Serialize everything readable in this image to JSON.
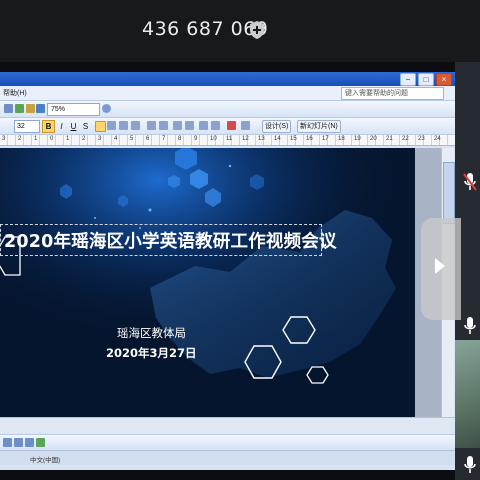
{
  "meeting": {
    "id": "436 687 069",
    "icon": "shield-plus-icon"
  },
  "ppt": {
    "window_buttons": [
      "−",
      "□",
      "×"
    ],
    "menu_help": "帮助(H)",
    "help_search_placeholder": "键入需要帮助的问题",
    "zoom": "75%",
    "font_size": "32",
    "format_buttons": [
      "B",
      "I",
      "U",
      "S"
    ],
    "design_button": "设计(S)",
    "new_slide_button": "新幻灯片(N)",
    "ruler_labels": [
      "3",
      "2",
      "1",
      "0",
      "1",
      "2",
      "3",
      "4",
      "5",
      "6",
      "7",
      "8",
      "9",
      "10",
      "11",
      "12",
      "13",
      "14",
      "15",
      "16",
      "17",
      "18",
      "19",
      "20",
      "21",
      "22",
      "23",
      "24"
    ],
    "status_language": "中文(中国)"
  },
  "slide": {
    "title": "2020年瑶海区小学英语教研工作视频会议",
    "organization": "瑶海区教体局",
    "date": "2020年3月27日",
    "colors": {
      "background": "#05152e",
      "accent": "#1f6fd6",
      "text": "#ffffff"
    }
  },
  "sidebar": {
    "icons": [
      "mic-muted-icon",
      "arrow-right-icon",
      "mic-icon",
      "mic-icon"
    ]
  }
}
